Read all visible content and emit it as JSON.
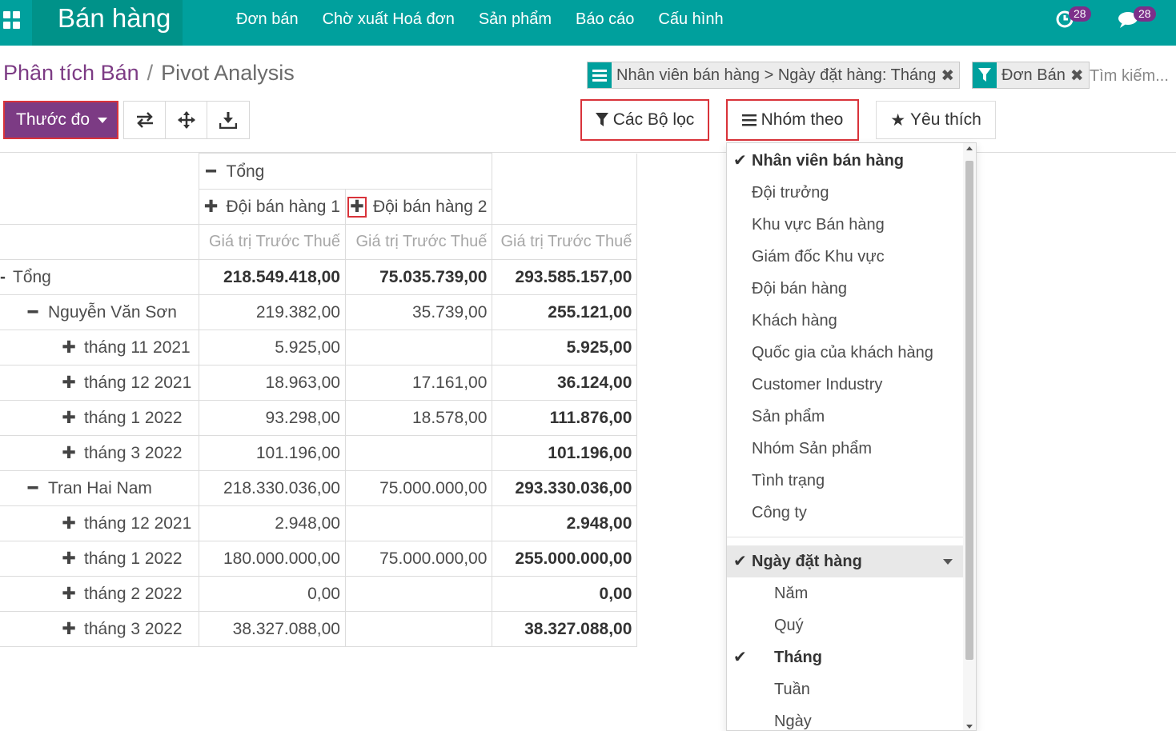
{
  "app": {
    "title": "Bán hàng",
    "menu": [
      "Đơn bán",
      "Chờ xuất Hoá đơn",
      "Sản phẩm",
      "Báo cáo",
      "Cấu hình"
    ],
    "activity_count": "28",
    "message_count": "28"
  },
  "breadcrumb": {
    "parent": "Phân tích Bán",
    "separator": "/",
    "current": "Pivot Analysis"
  },
  "search": {
    "facet_groupby": "Nhân viên bán hàng > Ngày đặt hàng: Tháng",
    "facet_filter": "Đơn Bán",
    "placeholder": "Tìm kiếm..."
  },
  "toolbar": {
    "measures": "Thước đo",
    "filters": "Các Bộ lọc",
    "groupby": "Nhóm theo",
    "favorites": "Yêu thích"
  },
  "pivot": {
    "col_total": "Tổng",
    "col_groups": [
      "Đội bán hàng 1",
      "Đội bán hàng 2"
    ],
    "measure": "Giá trị Trước Thuế",
    "rows": [
      {
        "label": "Tổng",
        "v1": "218.549.418,00",
        "v2": "75.035.739,00",
        "total": "293.585.157,00"
      },
      {
        "label": "Nguyễn Văn Sơn",
        "v1": "219.382,00",
        "v2": "35.739,00",
        "total": "255.121,00"
      },
      {
        "label": "tháng 11 2021",
        "v1": "5.925,00",
        "v2": "",
        "total": "5.925,00"
      },
      {
        "label": "tháng 12 2021",
        "v1": "18.963,00",
        "v2": "17.161,00",
        "total": "36.124,00"
      },
      {
        "label": "tháng 1 2022",
        "v1": "93.298,00",
        "v2": "18.578,00",
        "total": "111.876,00"
      },
      {
        "label": "tháng 3 2022",
        "v1": "101.196,00",
        "v2": "",
        "total": "101.196,00"
      },
      {
        "label": "Tran Hai Nam",
        "v1": "218.330.036,00",
        "v2": "75.000.000,00",
        "total": "293.330.036,00"
      },
      {
        "label": "tháng 12 2021",
        "v1": "2.948,00",
        "v2": "",
        "total": "2.948,00"
      },
      {
        "label": "tháng 1 2022",
        "v1": "180.000.000,00",
        "v2": "75.000.000,00",
        "total": "255.000.000,00"
      },
      {
        "label": "tháng 2 2022",
        "v1": "0,00",
        "v2": "",
        "total": "0,00"
      },
      {
        "label": "tháng 3 2022",
        "v1": "38.327.088,00",
        "v2": "",
        "total": "38.327.088,00"
      }
    ]
  },
  "groupby_menu": {
    "items": [
      "Nhân viên bán hàng",
      "Đội trưởng",
      "Khu vực Bán hàng",
      "Giám đốc Khu vực",
      "Đội bán hàng",
      "Khách hàng",
      "Quốc gia của khách hàng",
      "Customer Industry",
      "Sản phẩm",
      "Nhóm Sản phẩm",
      "Tình trạng",
      "Công ty"
    ],
    "date_field": "Ngày đặt hàng",
    "date_options": [
      "Năm",
      "Quý",
      "Tháng",
      "Tuần",
      "Ngày"
    ]
  },
  "colors": {
    "navbar": "#00A09D",
    "primary": "#7c3b84",
    "highlight_border": "#d9333a"
  }
}
